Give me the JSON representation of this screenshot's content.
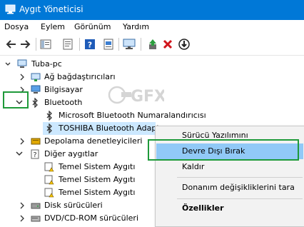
{
  "window": {
    "title": "Aygıt Yöneticisi"
  },
  "menu": {
    "items": [
      "Dosya",
      "Eylem",
      "Görünüm",
      "Yardım"
    ]
  },
  "toolbar": {
    "buttons": [
      "back-arrow-icon",
      "forward-arrow-icon",
      "show-hide-tree-icon",
      "properties-icon",
      "help-icon",
      "scan-hardware-icon",
      "monitor-icon",
      "update-driver-icon",
      "uninstall-icon",
      "download-icon"
    ]
  },
  "tree": {
    "root": "Tuba-pc",
    "items": [
      "Ağ bağdaştırıcıları",
      "Bilgisayar",
      "Bluetooth",
      "Microsoft Bluetooth Numaralandırıcısı",
      "TOSHIBA Bluetooth Adapt",
      "Depolama denetleyicileri",
      "Diğer aygıtlar",
      "Temel Sistem Aygıtı",
      "Temel Sistem Aygıtı",
      "Temel Sistem Aygıtı",
      "Disk sürücüleri",
      "DVD/CD-ROM sürücüleri"
    ]
  },
  "context_menu": {
    "update_driver": "Sürücü Yazılımını Güncelleştir...",
    "disable": "Devre Dışı Bırak",
    "uninstall": "Kaldır",
    "scan": "Donanım değişikliklerini tara",
    "properties": "Özellikler"
  },
  "watermark": {
    "text": "GFX"
  },
  "colors": {
    "titlebar": "#0078d7",
    "highlight": "#91c9f7",
    "selection": "#cce8ff",
    "annotation": "#1f9a3a"
  }
}
